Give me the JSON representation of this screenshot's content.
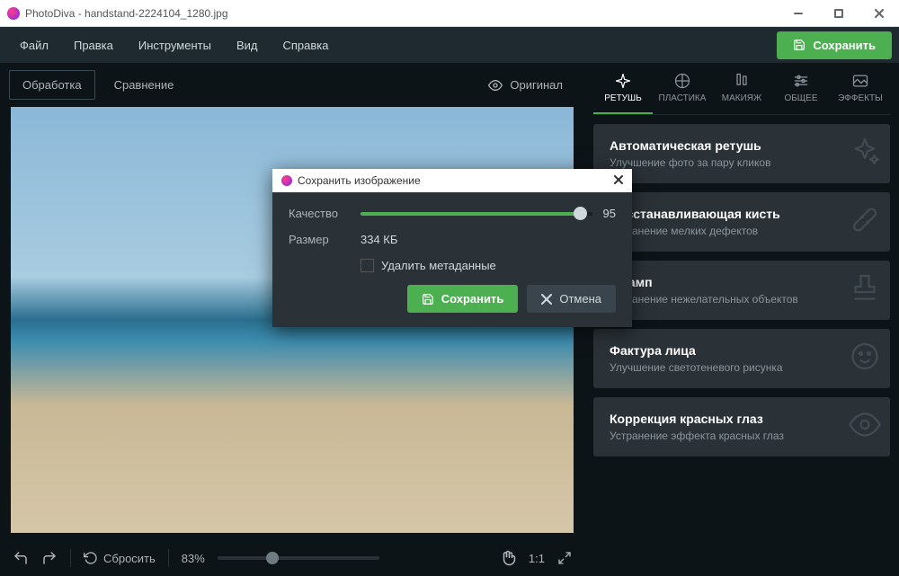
{
  "title": "PhotoDiva - handstand-2224104_1280.jpg",
  "menu": [
    "Файл",
    "Правка",
    "Инструменты",
    "Вид",
    "Справка"
  ],
  "save_btn": "Сохранить",
  "tabs": {
    "process": "Обработка",
    "compare": "Сравнение",
    "original": "Оригинал"
  },
  "bottombar": {
    "reset": "Сбросить",
    "zoom_pct": "83%",
    "ratio": "1:1"
  },
  "tool_tabs": [
    "РЕТУШЬ",
    "ПЛАСТИКА",
    "МАКИЯЖ",
    "ОБЩЕЕ",
    "ЭФФЕКТЫ"
  ],
  "cards": [
    {
      "t": "Автоматическая ретушь",
      "s": "Улучшение фото за пару кликов"
    },
    {
      "t": "Восстанавливающая кисть",
      "s": "Устранение мелких дефектов"
    },
    {
      "t": "Штамп",
      "s": "Устранение нежелательных объектов"
    },
    {
      "t": "Фактура лица",
      "s": "Улучшение светотеневого рисунка"
    },
    {
      "t": "Коррекция красных глаз",
      "s": "Устранение эффекта красных глаз"
    }
  ],
  "dialog": {
    "title": "Сохранить изображение",
    "quality_label": "Качество",
    "quality_value": "95",
    "size_label": "Размер",
    "size_value": "334 КБ",
    "meta_label": "Удалить метаданные",
    "save": "Сохранить",
    "cancel": "Отмена"
  }
}
